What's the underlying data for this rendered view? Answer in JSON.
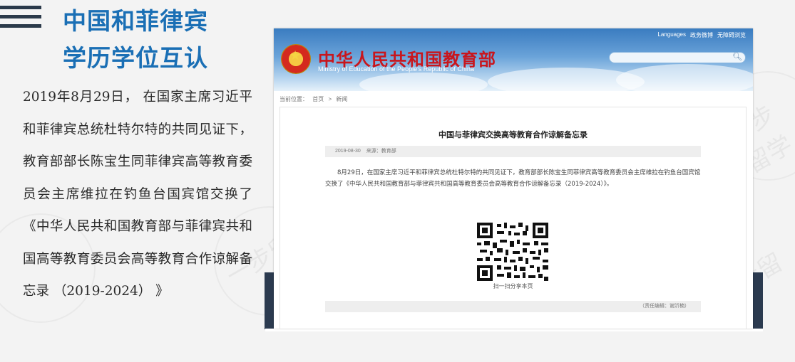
{
  "heading": {
    "line1": "中国和菲律宾",
    "line2": "学历学位互认"
  },
  "body_text": "2019年8月29日， 在国家主席习近平和菲律宾总统杜特尔特的共同见证下， 教育部部长陈宝生同菲律宾高等教育委员会主席维拉在钓鱼台国宾馆交换了《中华人民共和国教育部与菲律宾共和国高等教育委员会高等教育合作谅解备忘录 （2019-2024） 》",
  "watermark": "一步留学",
  "screenshot": {
    "site_name": "中华人民共和国教育部",
    "site_name_en": "Ministry of Education of the People's Republic of China",
    "top_links": [
      "Languages",
      "政务微博",
      "无障碍浏览"
    ],
    "breadcrumb": [
      "当前位置：",
      "首页",
      ">",
      "新闻"
    ],
    "article_title": "中国与菲律宾交换高等教育合作谅解备忘录",
    "date": "2019-08-30",
    "source": "来源：教育部",
    "paragraph": "8月29日，在国家主席习近平和菲律宾总统杜特尔特的共同见证下，教育部部长陈宝生同菲律宾高等教育委员会主席维拉在钓鱼台国宾馆交换了《中华人民共和国教育部与菲律宾共和国高等教育委员会高等教育合作谅解备忘录（2019-2024）》。",
    "qr_caption": "扫一扫分享本页",
    "editor": "（责任编辑：谢沂楠）"
  },
  "colors": {
    "title": "#1a6fb5",
    "frame": "#2b3a4f",
    "site_name": "#c8161d"
  }
}
